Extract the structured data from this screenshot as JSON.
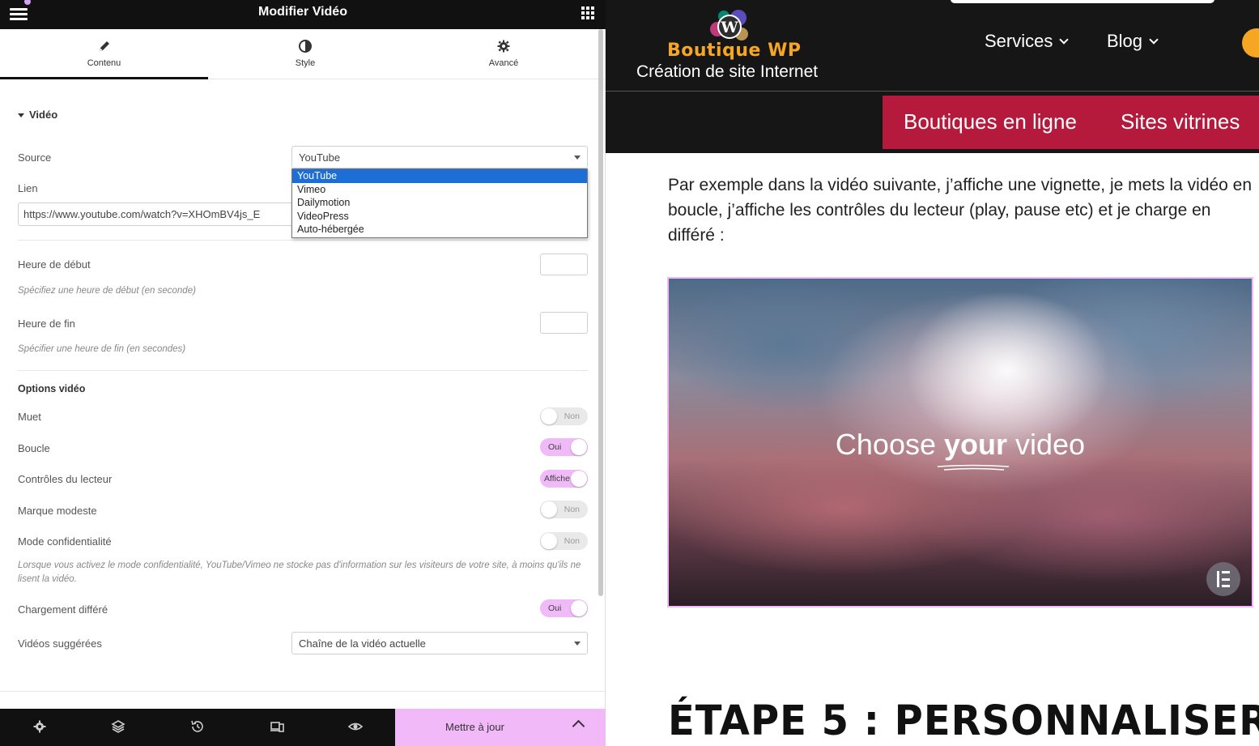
{
  "editor": {
    "title": "Modifier Vidéo",
    "tabs": [
      {
        "label": "Contenu",
        "icon": "pencil-icon"
      },
      {
        "label": "Style",
        "icon": "contrast-icon"
      },
      {
        "label": "Avancé",
        "icon": "gear-icon"
      }
    ],
    "section_title": "Vidéo",
    "source": {
      "label": "Source",
      "value": "YouTube",
      "options": [
        "YouTube",
        "Vimeo",
        "Dailymotion",
        "VideoPress",
        "Auto-hébergée"
      ]
    },
    "link": {
      "label": "Lien",
      "value": "https://www.youtube.com/watch?v=XHOmBV4js_E"
    },
    "start": {
      "label": "Heure de début",
      "hint": "Spécifiez une heure de début (en seconde)"
    },
    "end": {
      "label": "Heure de fin",
      "hint": "Spécifier une heure de fin (en secondes)"
    },
    "options_title": "Options vidéo",
    "toggles": {
      "muet": {
        "label": "Muet",
        "state": "Non"
      },
      "boucle": {
        "label": "Boucle",
        "state": "Oui"
      },
      "controles": {
        "label": "Contrôles du lecteur",
        "state": "Affiche"
      },
      "marque": {
        "label": "Marque modeste",
        "state": "Non"
      },
      "confidentialite": {
        "label": "Mode confidentialité",
        "state": "Non"
      },
      "differe": {
        "label": "Chargement différé",
        "state": "Oui"
      }
    },
    "privacy_hint": "Lorsque vous activez le mode confidentialité, YouTube/Vimeo ne stocke pas d'information sur les visiteurs de votre site, à moins qu'ils ne lisent la vidéo.",
    "suggested": {
      "label": "Vidéos suggérées",
      "value": "Chaîne de la vidéo actuelle"
    },
    "update_button": "Mettre à jour",
    "footer_icons": [
      "gear-icon",
      "layers-icon",
      "history-icon",
      "responsive-icon",
      "eye-icon"
    ]
  },
  "site": {
    "logo_name": "Boutique WP",
    "logo_sub": "Création de site Internet",
    "nav": [
      "Services",
      "Blog"
    ],
    "subnav": [
      "Boutiques en ligne",
      "Sites vitrines"
    ],
    "paragraph": "Par exemple dans la vidéo suivante, j’affiche une vignette, je mets la vidéo en boucle, j’affiche les contrôles du lecteur (play, pause etc) et je charge en différé :",
    "video_title_pre": "Choose ",
    "video_title_bold": "your",
    "video_title_post": " video",
    "step_title": "ÉTAPE 5 : PERSONNALISER"
  },
  "colors": {
    "accent_pink": "#f2b9f8",
    "brand_red": "#b5193c",
    "logo_orange": "#f5a623",
    "dark": "#161616"
  }
}
